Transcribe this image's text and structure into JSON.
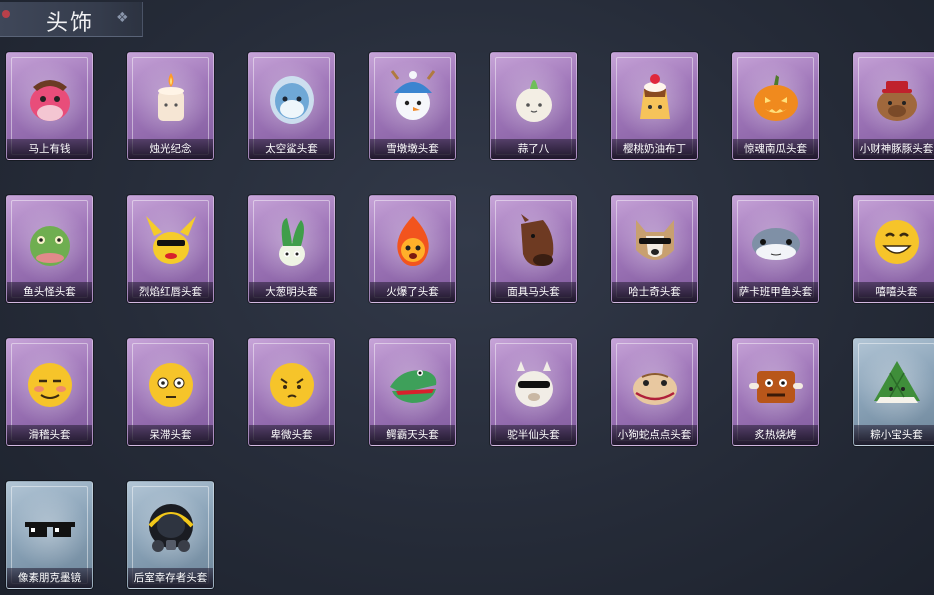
{
  "header": {
    "title": "头饰"
  },
  "items": [
    {
      "label": "马上有钱",
      "icon": "horse-head-icon",
      "rarity": "purple"
    },
    {
      "label": "烛光纪念",
      "icon": "candle-icon",
      "rarity": "purple"
    },
    {
      "label": "太空鲨头套",
      "icon": "space-shark-icon",
      "rarity": "purple"
    },
    {
      "label": "雪墩墩头套",
      "icon": "snowman-icon",
      "rarity": "purple"
    },
    {
      "label": "蒜了八",
      "icon": "garlic-icon",
      "rarity": "purple"
    },
    {
      "label": "樱桃奶油布丁",
      "icon": "pudding-icon",
      "rarity": "purple"
    },
    {
      "label": "惊魂南瓜头套",
      "icon": "pumpkin-icon",
      "rarity": "purple"
    },
    {
      "label": "小财神豚豚头套",
      "icon": "capybara-icon",
      "rarity": "purple"
    },
    {
      "label": "鱼头怪头套",
      "icon": "fish-head-icon",
      "rarity": "purple"
    },
    {
      "label": "烈焰红唇头套",
      "icon": "electric-mouse-icon",
      "rarity": "purple"
    },
    {
      "label": "大葱明头套",
      "icon": "scallion-icon",
      "rarity": "purple"
    },
    {
      "label": "火爆了头套",
      "icon": "fireball-icon",
      "rarity": "purple"
    },
    {
      "label": "面具马头套",
      "icon": "horse-mask-icon",
      "rarity": "purple"
    },
    {
      "label": "哈士奇头套",
      "icon": "husky-icon",
      "rarity": "purple"
    },
    {
      "label": "萨卡班甲鱼头套",
      "icon": "sacabambaspis-icon",
      "rarity": "purple"
    },
    {
      "label": "嘻嘻头套",
      "icon": "grin-emoji-icon",
      "rarity": "purple"
    },
    {
      "label": "滑稽头套",
      "icon": "funny-emoji-icon",
      "rarity": "purple"
    },
    {
      "label": "呆滞头套",
      "icon": "dazed-emoji-icon",
      "rarity": "purple"
    },
    {
      "label": "卑微头套",
      "icon": "humble-emoji-icon",
      "rarity": "purple"
    },
    {
      "label": "鳄霸天头套",
      "icon": "crocodile-icon",
      "rarity": "purple"
    },
    {
      "label": "驼半仙头套",
      "icon": "alpaca-icon",
      "rarity": "purple"
    },
    {
      "label": "小狗蛇点点头套",
      "icon": "snake-icon",
      "rarity": "purple"
    },
    {
      "label": "炙热烧烤",
      "icon": "barbecue-icon",
      "rarity": "purple"
    },
    {
      "label": "粽小宝头套",
      "icon": "zongzi-icon",
      "rarity": "blue"
    },
    {
      "label": "像素朋克墨镜",
      "icon": "pixel-sunglasses-icon",
      "rarity": "blue"
    },
    {
      "label": "后室幸存者头套",
      "icon": "gas-mask-helmet-icon",
      "rarity": "blue"
    }
  ],
  "colors": {
    "purple_card": "#9e75b8",
    "blue_card": "#8aa3b8",
    "background": "#262c39"
  }
}
